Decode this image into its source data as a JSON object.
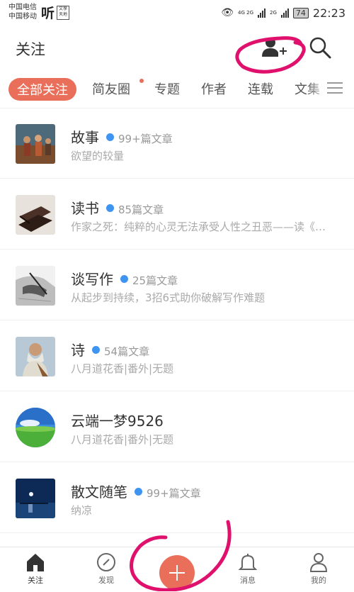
{
  "status_bar": {
    "carrier_1": "中国电信",
    "carrier_2": "中国移动",
    "app_glyph": "听",
    "mini_app": "文學 天地",
    "network_1": "4G 2G",
    "network_2": "2G",
    "battery": "74",
    "time": "22:23"
  },
  "header": {
    "title": "关注",
    "add_icon": "add-user-icon",
    "search_icon": "search-icon"
  },
  "tabs": [
    {
      "label": "全部关注",
      "active": true
    },
    {
      "label": "简友圈",
      "has_dot": true
    },
    {
      "label": "专题"
    },
    {
      "label": "作者"
    },
    {
      "label": "连载"
    },
    {
      "label": "文集"
    }
  ],
  "list": [
    {
      "name": "故事",
      "count": "99+篇文章",
      "desc": "欲望的较量"
    },
    {
      "name": "读书",
      "count": "85篇文章",
      "desc": "作家之死：纯粹的心灵无法承受人性之丑恶——读《…"
    },
    {
      "name": "谈写作",
      "count": "25篇文章",
      "desc": "从起步到持续，3招6式助你破解写作难题"
    },
    {
      "name": "诗",
      "count": "54篇文章",
      "desc": "八月道花香|番外|无题"
    },
    {
      "name": "云端一梦9526",
      "count": "",
      "desc": "八月道花香|番外|无题"
    },
    {
      "name": "散文随笔",
      "count": "99+篇文章",
      "desc": "纳凉"
    }
  ],
  "bottom_nav": {
    "home": "关注",
    "discover": "发现",
    "messages": "消息",
    "mine": "我的"
  },
  "colors": {
    "accent": "#ea6f5a",
    "dot_blue": "#3f94f2",
    "annotation_pink": "#e0106d"
  }
}
